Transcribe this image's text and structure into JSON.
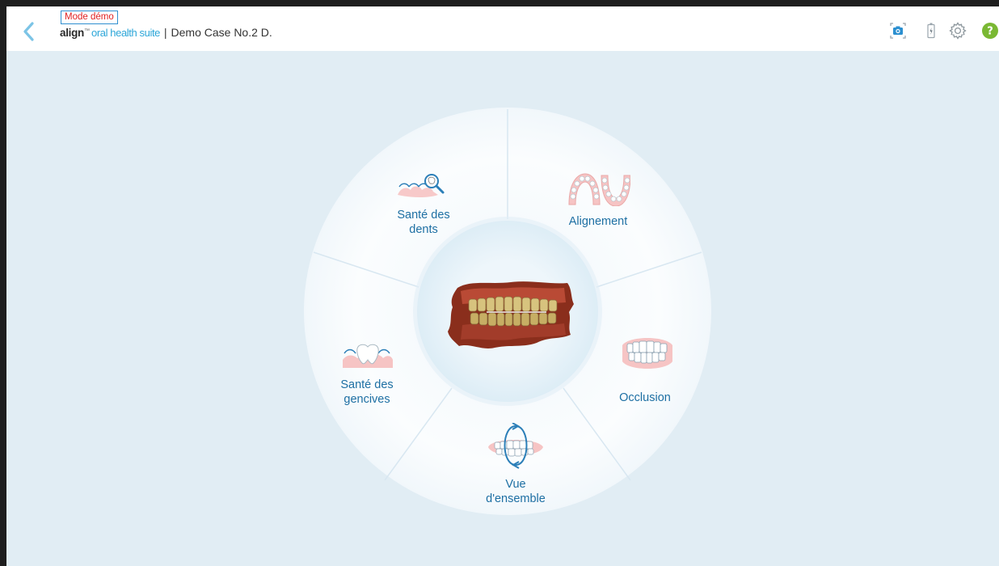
{
  "header": {
    "demo_badge": "Mode démo",
    "brand_align": "align",
    "brand_suite": "oral health suite",
    "separator": "|",
    "case_title": "Demo Case No.2 D."
  },
  "toolbar": {
    "icons": [
      "camera-icon",
      "battery-icon",
      "settings-gear-icon",
      "help-icon"
    ],
    "help_glyph": "?"
  },
  "wheel": {
    "segments": [
      {
        "id": "tooth-health",
        "label_lines": [
          "Santé des",
          "dents"
        ],
        "icon": "tooth-magnifier-icon"
      },
      {
        "id": "alignment",
        "label_lines": [
          "Alignement"
        ],
        "icon": "dental-arches-icon"
      },
      {
        "id": "occlusion",
        "label_lines": [
          "Occlusion"
        ],
        "icon": "teeth-bite-icon"
      },
      {
        "id": "overview",
        "label_lines": [
          "Vue",
          "d'ensemble"
        ],
        "icon": "rotate-jaw-icon"
      },
      {
        "id": "gum-health",
        "label_lines": [
          "Santé des",
          "gencives"
        ],
        "icon": "gum-tooth-icon"
      }
    ],
    "center": "3d-dental-scan-model"
  },
  "colors": {
    "accent": "#2ca6d8",
    "label": "#1d6fa3",
    "background": "#e1edf4",
    "demo_badge_text": "#e02222",
    "help": "#7ab833"
  }
}
